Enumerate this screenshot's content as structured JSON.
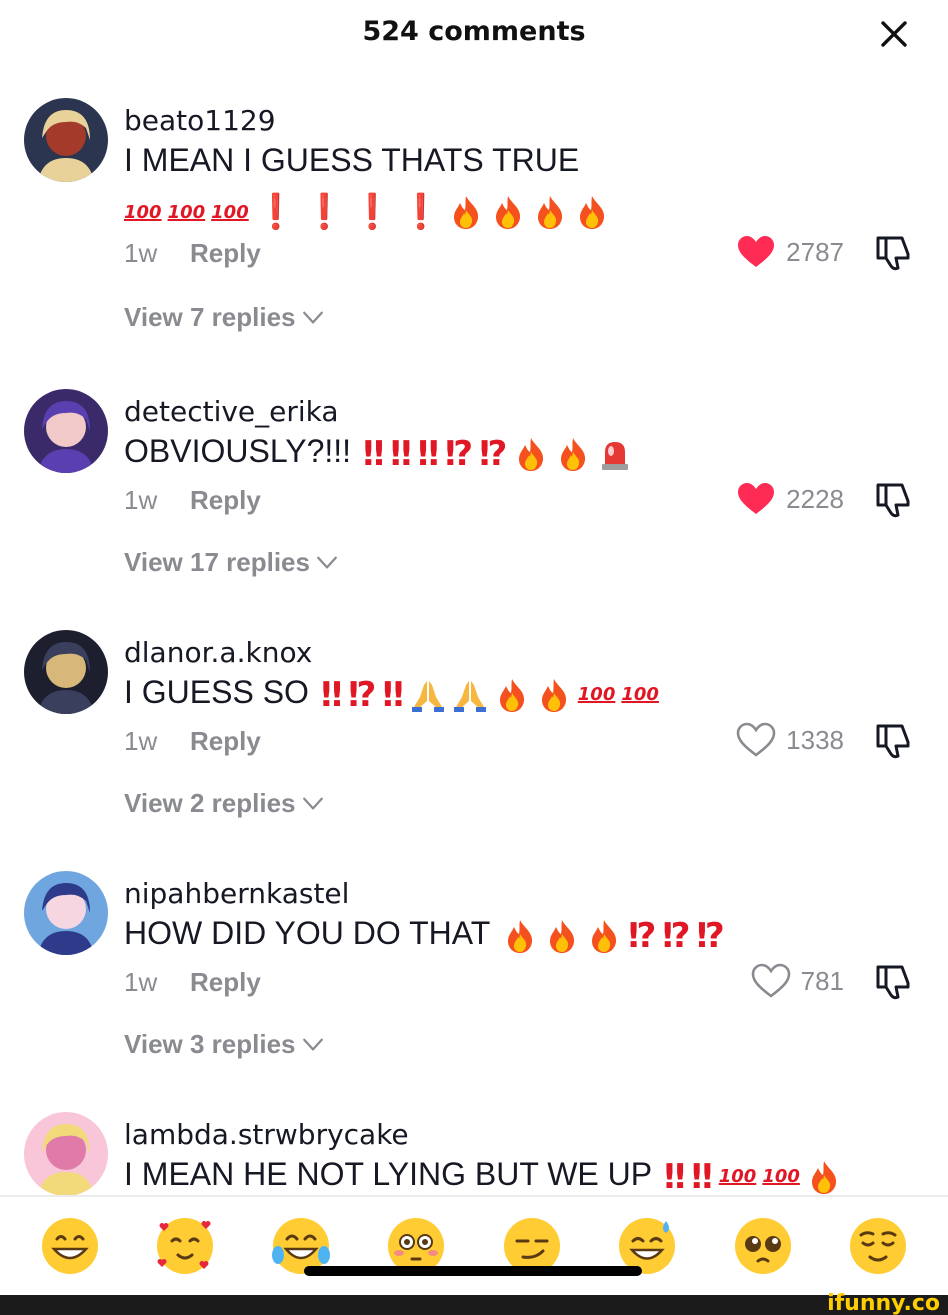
{
  "header": {
    "title": "524 comments"
  },
  "comments": [
    {
      "username": "beato1129",
      "text": "I MEAN I GUESS THATS TRUE",
      "emojis": [
        "100",
        "100",
        "100",
        "!",
        "!",
        "!",
        "!",
        "fire",
        "fire",
        "fire",
        "fire"
      ],
      "time": "1w",
      "reply_label": "Reply",
      "likes": "2787",
      "liked": true,
      "view_replies": "View 7 replies"
    },
    {
      "username": "detective_erika",
      "text": "OBVIOUSLY?!!!",
      "emojis": [
        "!!",
        "!!",
        "!!",
        "!?",
        "!?",
        "fire",
        "fire",
        "siren"
      ],
      "time": "1w",
      "reply_label": "Reply",
      "likes": "2228",
      "liked": true,
      "view_replies": "View 17 replies"
    },
    {
      "username": "dlanor.a.knox",
      "text": "I GUESS SO",
      "emojis": [
        "!!",
        "!?",
        "!!",
        "pray",
        "pray",
        "fire",
        "fire",
        "100",
        "100"
      ],
      "time": "1w",
      "reply_label": "Reply",
      "likes": "1338",
      "liked": false,
      "view_replies": "View 2 replies"
    },
    {
      "username": "nipahbernkastel",
      "text": "HOW DID YOU DO THAT",
      "emojis": [
        "fire",
        "fire",
        "fire",
        "!?",
        "!?",
        "!?"
      ],
      "time": "1w",
      "reply_label": "Reply",
      "likes": "781",
      "liked": false,
      "view_replies": "View 3 replies"
    },
    {
      "username": "lambda.strwbrycake",
      "text": "I MEAN HE NOT LYING BUT WE UP",
      "emojis": [
        "!!",
        "!!",
        "100",
        "100",
        "fire"
      ],
      "time": "",
      "reply_label": "",
      "likes": "",
      "liked": false,
      "view_replies": ""
    }
  ],
  "quick_emojis": [
    "grin-emoji",
    "hearts-face-emoji",
    "tears-of-joy-emoji",
    "flushed-emoji",
    "smirk-emoji",
    "sweat-smile-emoji",
    "pleading-emoji",
    "relieved-emoji"
  ],
  "watermark": "ifunny.co",
  "colors": {
    "like_red": "#fe2c55",
    "emoji_red": "#e01826",
    "meta_gray": "#8a8b91"
  }
}
